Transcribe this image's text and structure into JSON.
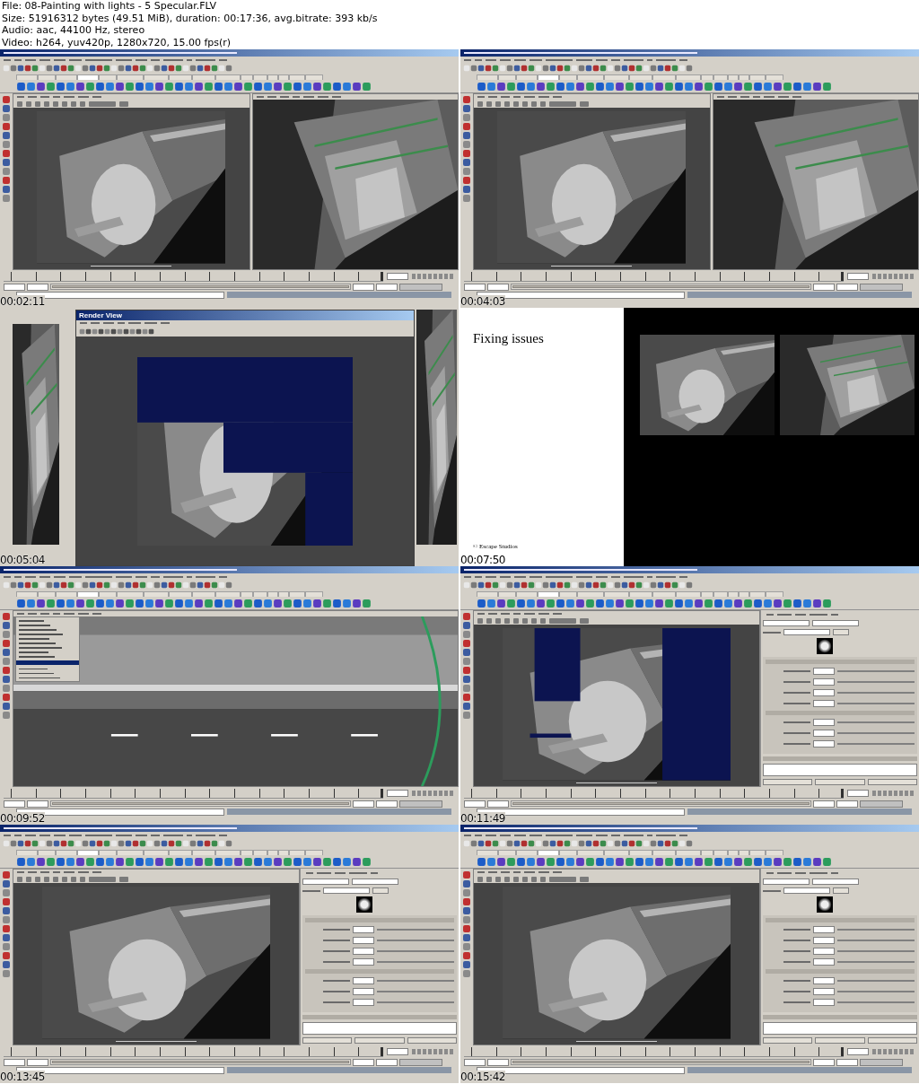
{
  "header": [
    "File: 08-Painting with lights - 5 Specular.FLV",
    "Size: 51916312 bytes (49.51 MiB), duration: 00:17:36, avg.bitrate: 393 kb/s",
    "Audio: aac, 44100 Hz, stereo",
    "Video: h264, yuv420p, 1280x720, 15.00 fps(r)"
  ],
  "frames": [
    {
      "kind": "maya",
      "viewports": [
        {
          "kind": "render"
        },
        {
          "kind": "persp"
        }
      ],
      "time_slider": {
        "level": 1
      },
      "range_slider": {
        "level": 1
      },
      "timestamp": "00:02:11"
    },
    {
      "kind": "maya",
      "viewports": [
        {
          "kind": "render"
        },
        {
          "kind": "persp"
        }
      ],
      "time_slider": {
        "level": 1
      },
      "range_slider": {
        "level": 1
      },
      "timestamp": "00:04:03"
    },
    {
      "kind": "render_window",
      "title": "Render View",
      "timestamp": "00:05:04"
    },
    {
      "kind": "slide",
      "heading": "Fixing issues",
      "footer": "© Escape Studios",
      "timestamp": "00:07:50"
    },
    {
      "kind": "maya",
      "viewports": [
        {
          "kind": "road",
          "menu_open": true
        }
      ],
      "time_slider": {
        "level": 1
      },
      "range_slider": {
        "level": 1
      },
      "timestamp": "00:09:52"
    },
    {
      "kind": "maya",
      "viewports": [
        {
          "kind": "render"
        }
      ],
      "panel": {
        "kind": "attribute_editor"
      },
      "time_slider": {
        "level": 1
      },
      "range_slider": {
        "level": 1
      },
      "timestamp": "00:11:49"
    },
    {
      "kind": "maya",
      "viewports": [
        {
          "kind": "render"
        }
      ],
      "panel": {
        "kind": "attribute_editor"
      },
      "time_slider": {
        "level": 1
      },
      "range_slider": {
        "level": 1
      },
      "timestamp": "00:13:45"
    },
    {
      "kind": "maya",
      "viewports": [
        {
          "kind": "render"
        }
      ],
      "panel": {
        "kind": "attribute_editor"
      },
      "time_slider": {
        "level": 1
      },
      "range_slider": {
        "level": 1
      },
      "timestamp": "00:15:42"
    }
  ]
}
